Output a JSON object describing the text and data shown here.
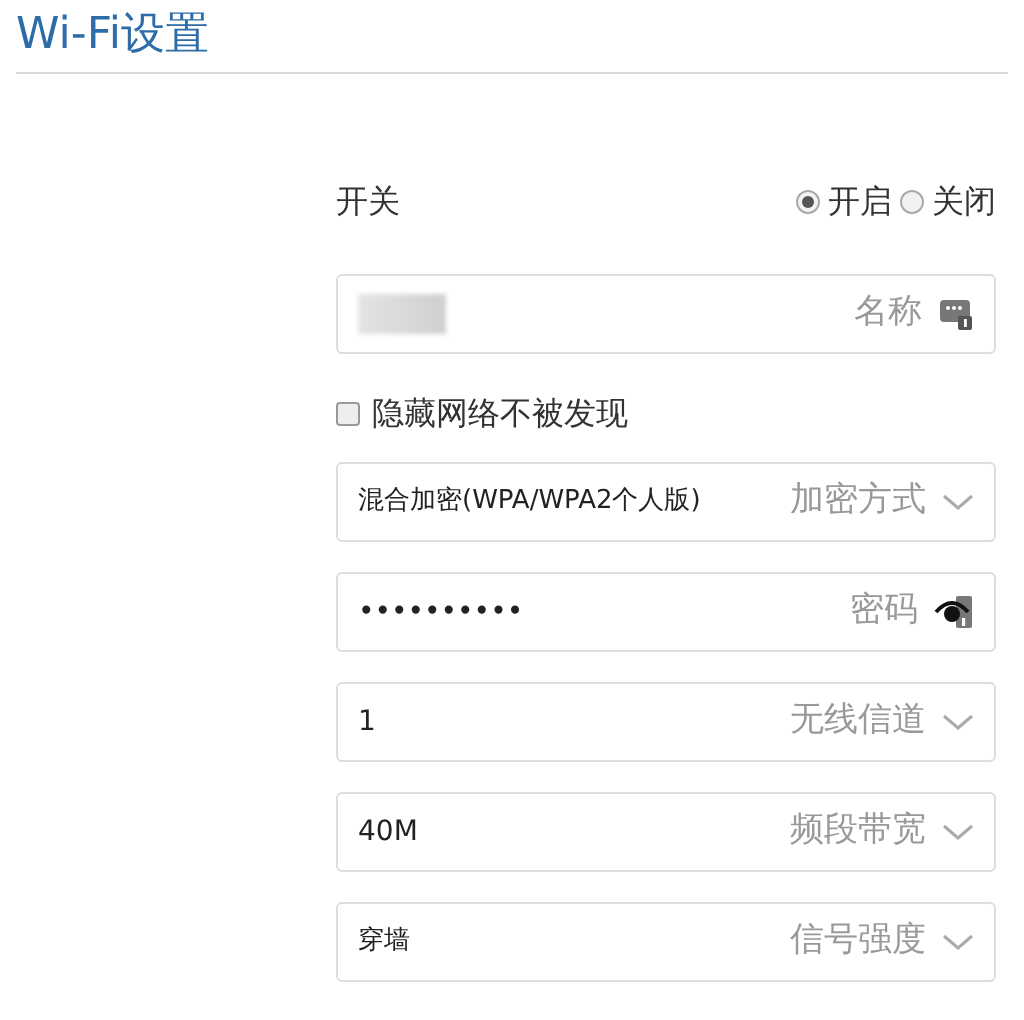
{
  "title": "Wi-Fi设置",
  "switch": {
    "label": "开关",
    "options": [
      {
        "label": "开启",
        "selected": true
      },
      {
        "label": "关闭",
        "selected": false
      }
    ]
  },
  "name_field": {
    "label": "名称"
  },
  "hide_network": {
    "label": "隐藏网络不被发现",
    "checked": false
  },
  "fields": [
    {
      "kind": "select",
      "value": "混合加密(WPA/WPA2个人版)",
      "label": "加密方式"
    },
    {
      "kind": "password",
      "value": "••••••••••",
      "label": "密码"
    },
    {
      "kind": "select",
      "value": "1",
      "label": "无线信道"
    },
    {
      "kind": "select",
      "value": "40M",
      "label": "频段带宽"
    },
    {
      "kind": "select",
      "value": "穿墙",
      "label": "信号强度"
    }
  ]
}
